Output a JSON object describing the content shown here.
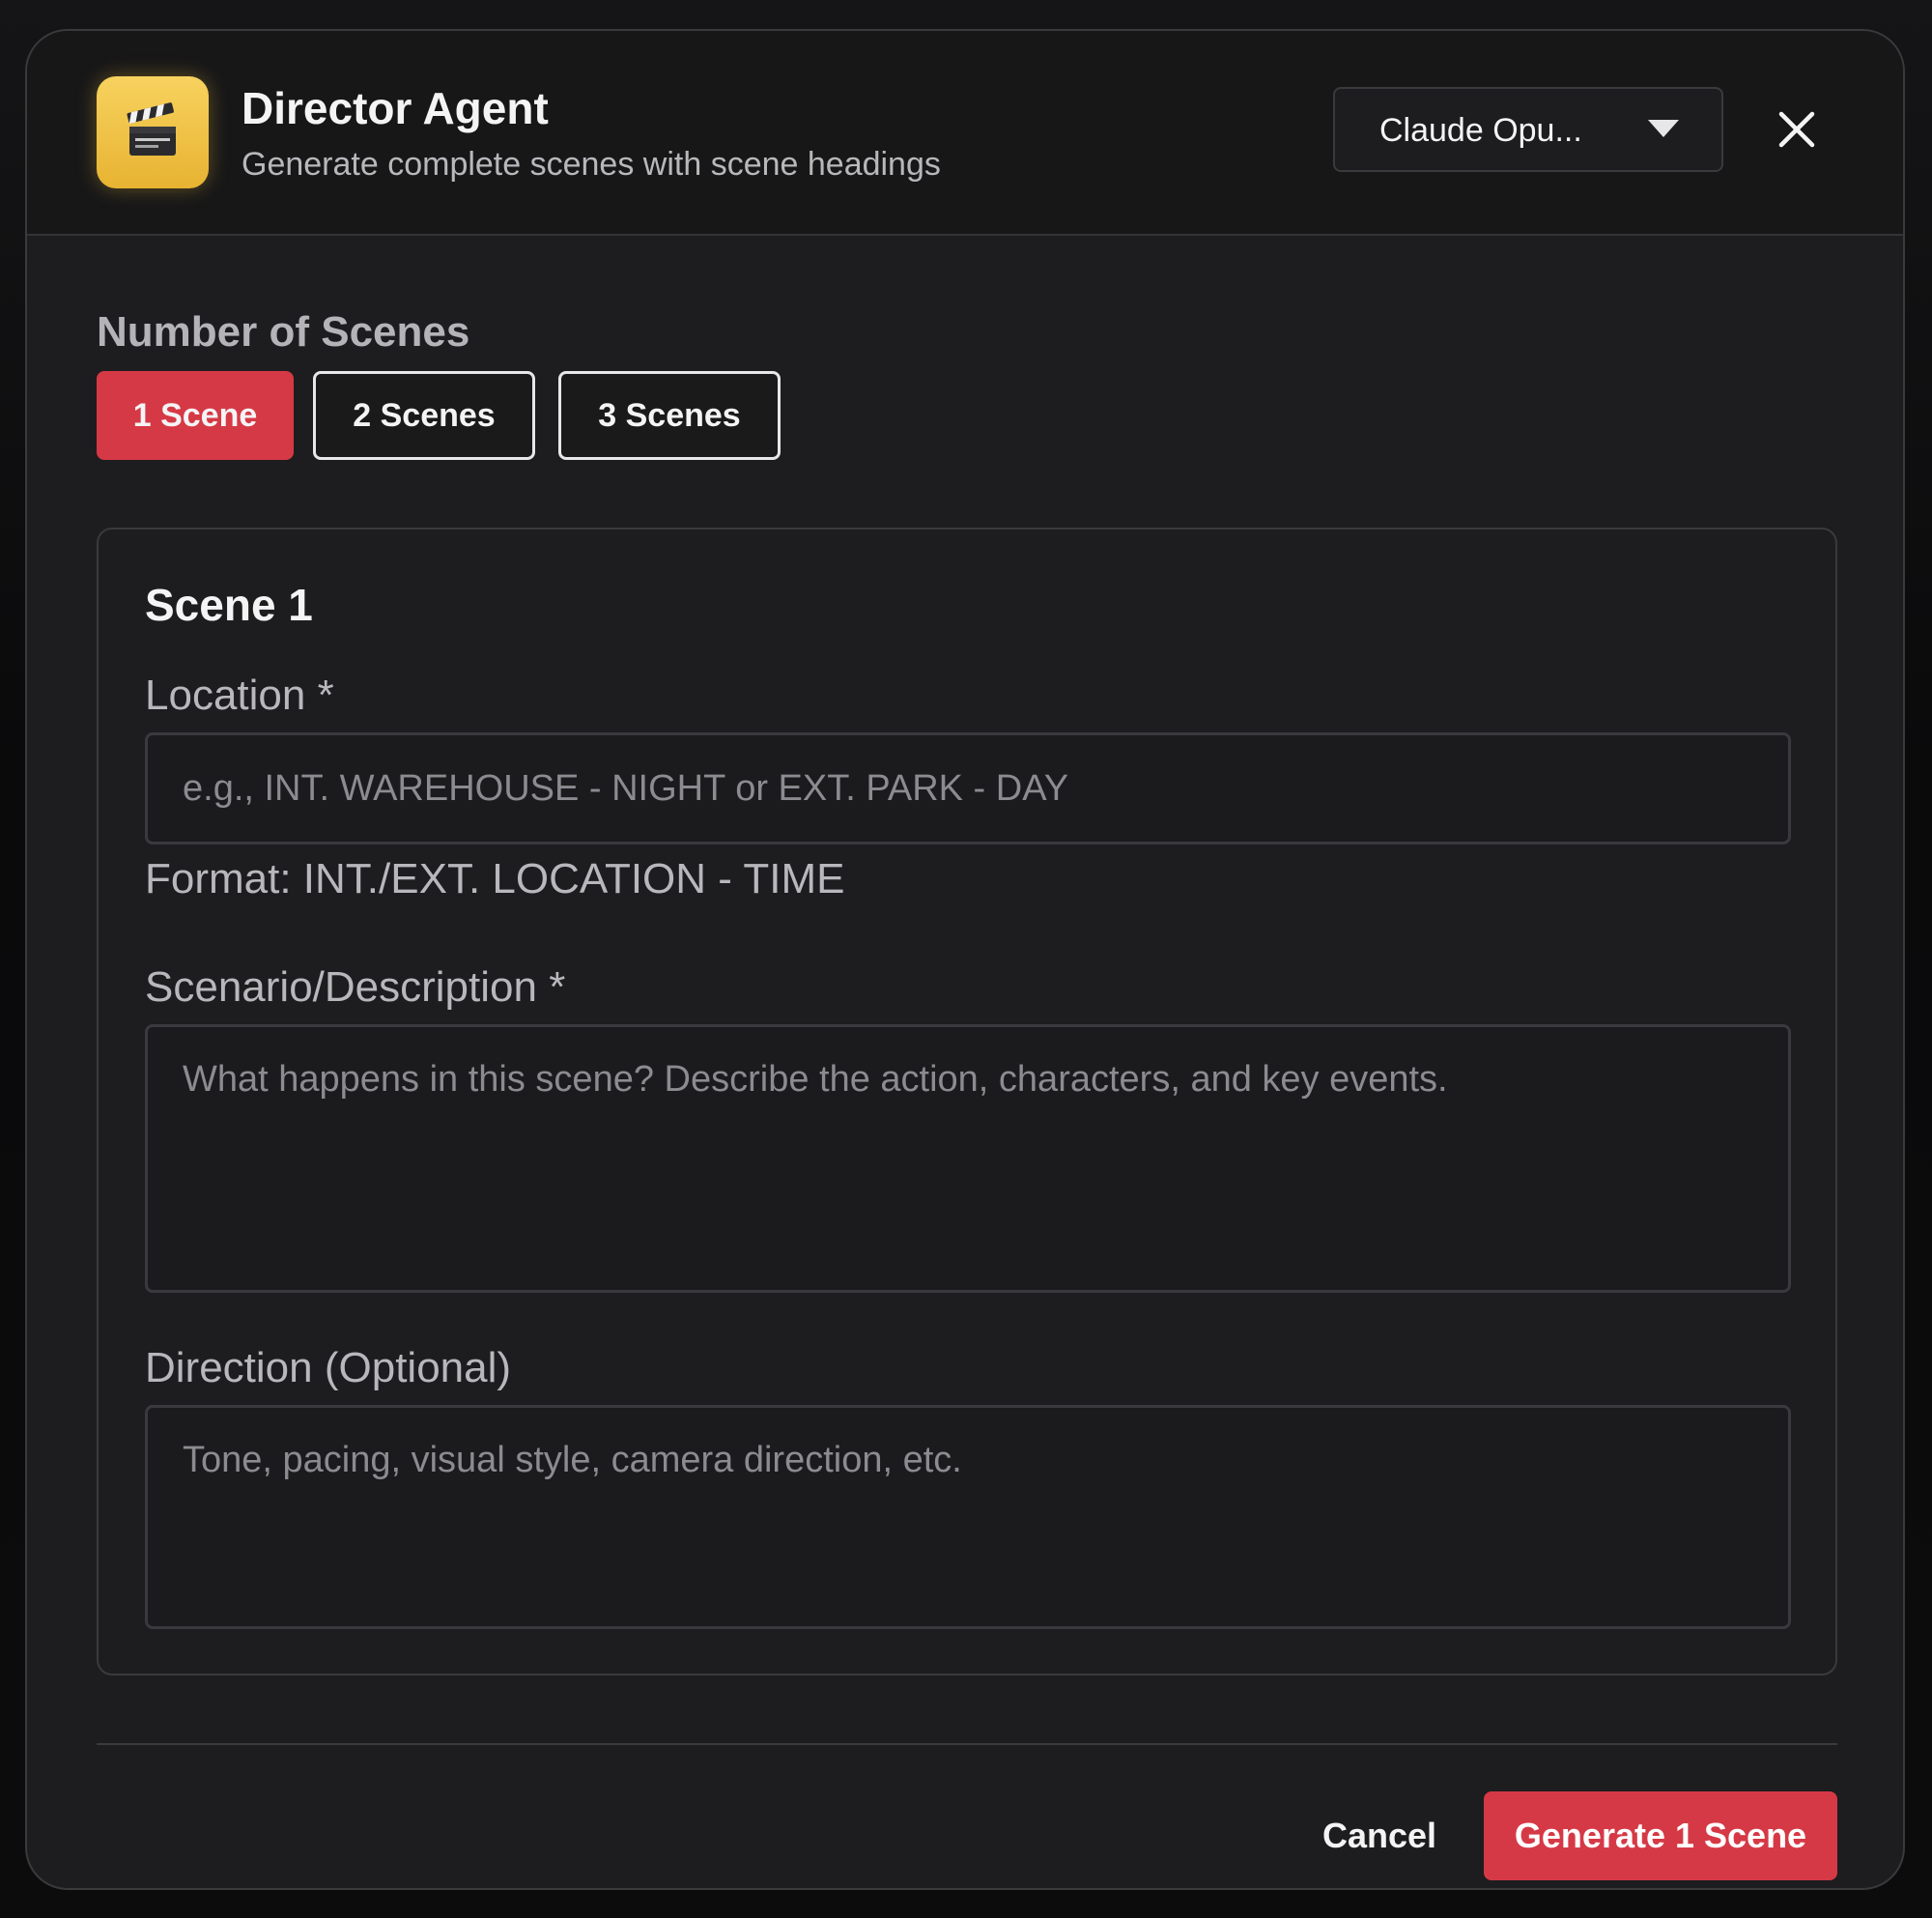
{
  "header": {
    "title": "Director Agent",
    "subtitle": "Generate complete scenes with scene headings",
    "icon": "clapperboard-icon",
    "model_select": {
      "value": "Claude Opu..."
    }
  },
  "scene_count": {
    "label": "Number of Scenes",
    "options": [
      "1 Scene",
      "2 Scenes",
      "3 Scenes"
    ],
    "selected_index": 0
  },
  "scene": {
    "title": "Scene 1",
    "location": {
      "label": "Location *",
      "value": "",
      "placeholder": "e.g., INT. WAREHOUSE - NIGHT or EXT. PARK - DAY",
      "hint": "Format: INT./EXT. LOCATION - TIME"
    },
    "scenario": {
      "label": "Scenario/Description *",
      "value": "",
      "placeholder": "What happens in this scene? Describe the action, characters, and key events."
    },
    "direction": {
      "label": "Direction (Optional)",
      "value": "",
      "placeholder": "Tone, pacing, visual style, camera direction, etc."
    }
  },
  "footer": {
    "cancel_label": "Cancel",
    "generate_label": "Generate 1 Scene"
  },
  "colors": {
    "accent": "#d63946",
    "icon_bg": "#f2c94c",
    "modal_bg": "#1d1d1f"
  }
}
